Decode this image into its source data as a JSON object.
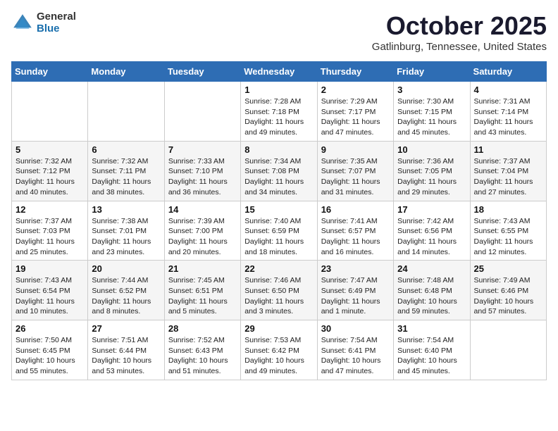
{
  "header": {
    "logo_general": "General",
    "logo_blue": "Blue",
    "month_title": "October 2025",
    "location": "Gatlinburg, Tennessee, United States"
  },
  "days_of_week": [
    "Sunday",
    "Monday",
    "Tuesday",
    "Wednesday",
    "Thursday",
    "Friday",
    "Saturday"
  ],
  "weeks": [
    [
      {
        "day": "",
        "info": ""
      },
      {
        "day": "",
        "info": ""
      },
      {
        "day": "",
        "info": ""
      },
      {
        "day": "1",
        "info": "Sunrise: 7:28 AM\nSunset: 7:18 PM\nDaylight: 11 hours\nand 49 minutes."
      },
      {
        "day": "2",
        "info": "Sunrise: 7:29 AM\nSunset: 7:17 PM\nDaylight: 11 hours\nand 47 minutes."
      },
      {
        "day": "3",
        "info": "Sunrise: 7:30 AM\nSunset: 7:15 PM\nDaylight: 11 hours\nand 45 minutes."
      },
      {
        "day": "4",
        "info": "Sunrise: 7:31 AM\nSunset: 7:14 PM\nDaylight: 11 hours\nand 43 minutes."
      }
    ],
    [
      {
        "day": "5",
        "info": "Sunrise: 7:32 AM\nSunset: 7:12 PM\nDaylight: 11 hours\nand 40 minutes."
      },
      {
        "day": "6",
        "info": "Sunrise: 7:32 AM\nSunset: 7:11 PM\nDaylight: 11 hours\nand 38 minutes."
      },
      {
        "day": "7",
        "info": "Sunrise: 7:33 AM\nSunset: 7:10 PM\nDaylight: 11 hours\nand 36 minutes."
      },
      {
        "day": "8",
        "info": "Sunrise: 7:34 AM\nSunset: 7:08 PM\nDaylight: 11 hours\nand 34 minutes."
      },
      {
        "day": "9",
        "info": "Sunrise: 7:35 AM\nSunset: 7:07 PM\nDaylight: 11 hours\nand 31 minutes."
      },
      {
        "day": "10",
        "info": "Sunrise: 7:36 AM\nSunset: 7:05 PM\nDaylight: 11 hours\nand 29 minutes."
      },
      {
        "day": "11",
        "info": "Sunrise: 7:37 AM\nSunset: 7:04 PM\nDaylight: 11 hours\nand 27 minutes."
      }
    ],
    [
      {
        "day": "12",
        "info": "Sunrise: 7:37 AM\nSunset: 7:03 PM\nDaylight: 11 hours\nand 25 minutes."
      },
      {
        "day": "13",
        "info": "Sunrise: 7:38 AM\nSunset: 7:01 PM\nDaylight: 11 hours\nand 23 minutes."
      },
      {
        "day": "14",
        "info": "Sunrise: 7:39 AM\nSunset: 7:00 PM\nDaylight: 11 hours\nand 20 minutes."
      },
      {
        "day": "15",
        "info": "Sunrise: 7:40 AM\nSunset: 6:59 PM\nDaylight: 11 hours\nand 18 minutes."
      },
      {
        "day": "16",
        "info": "Sunrise: 7:41 AM\nSunset: 6:57 PM\nDaylight: 11 hours\nand 16 minutes."
      },
      {
        "day": "17",
        "info": "Sunrise: 7:42 AM\nSunset: 6:56 PM\nDaylight: 11 hours\nand 14 minutes."
      },
      {
        "day": "18",
        "info": "Sunrise: 7:43 AM\nSunset: 6:55 PM\nDaylight: 11 hours\nand 12 minutes."
      }
    ],
    [
      {
        "day": "19",
        "info": "Sunrise: 7:43 AM\nSunset: 6:54 PM\nDaylight: 11 hours\nand 10 minutes."
      },
      {
        "day": "20",
        "info": "Sunrise: 7:44 AM\nSunset: 6:52 PM\nDaylight: 11 hours\nand 8 minutes."
      },
      {
        "day": "21",
        "info": "Sunrise: 7:45 AM\nSunset: 6:51 PM\nDaylight: 11 hours\nand 5 minutes."
      },
      {
        "day": "22",
        "info": "Sunrise: 7:46 AM\nSunset: 6:50 PM\nDaylight: 11 hours\nand 3 minutes."
      },
      {
        "day": "23",
        "info": "Sunrise: 7:47 AM\nSunset: 6:49 PM\nDaylight: 11 hours\nand 1 minute."
      },
      {
        "day": "24",
        "info": "Sunrise: 7:48 AM\nSunset: 6:48 PM\nDaylight: 10 hours\nand 59 minutes."
      },
      {
        "day": "25",
        "info": "Sunrise: 7:49 AM\nSunset: 6:46 PM\nDaylight: 10 hours\nand 57 minutes."
      }
    ],
    [
      {
        "day": "26",
        "info": "Sunrise: 7:50 AM\nSunset: 6:45 PM\nDaylight: 10 hours\nand 55 minutes."
      },
      {
        "day": "27",
        "info": "Sunrise: 7:51 AM\nSunset: 6:44 PM\nDaylight: 10 hours\nand 53 minutes."
      },
      {
        "day": "28",
        "info": "Sunrise: 7:52 AM\nSunset: 6:43 PM\nDaylight: 10 hours\nand 51 minutes."
      },
      {
        "day": "29",
        "info": "Sunrise: 7:53 AM\nSunset: 6:42 PM\nDaylight: 10 hours\nand 49 minutes."
      },
      {
        "day": "30",
        "info": "Sunrise: 7:54 AM\nSunset: 6:41 PM\nDaylight: 10 hours\nand 47 minutes."
      },
      {
        "day": "31",
        "info": "Sunrise: 7:54 AM\nSunset: 6:40 PM\nDaylight: 10 hours\nand 45 minutes."
      },
      {
        "day": "",
        "info": ""
      }
    ]
  ]
}
